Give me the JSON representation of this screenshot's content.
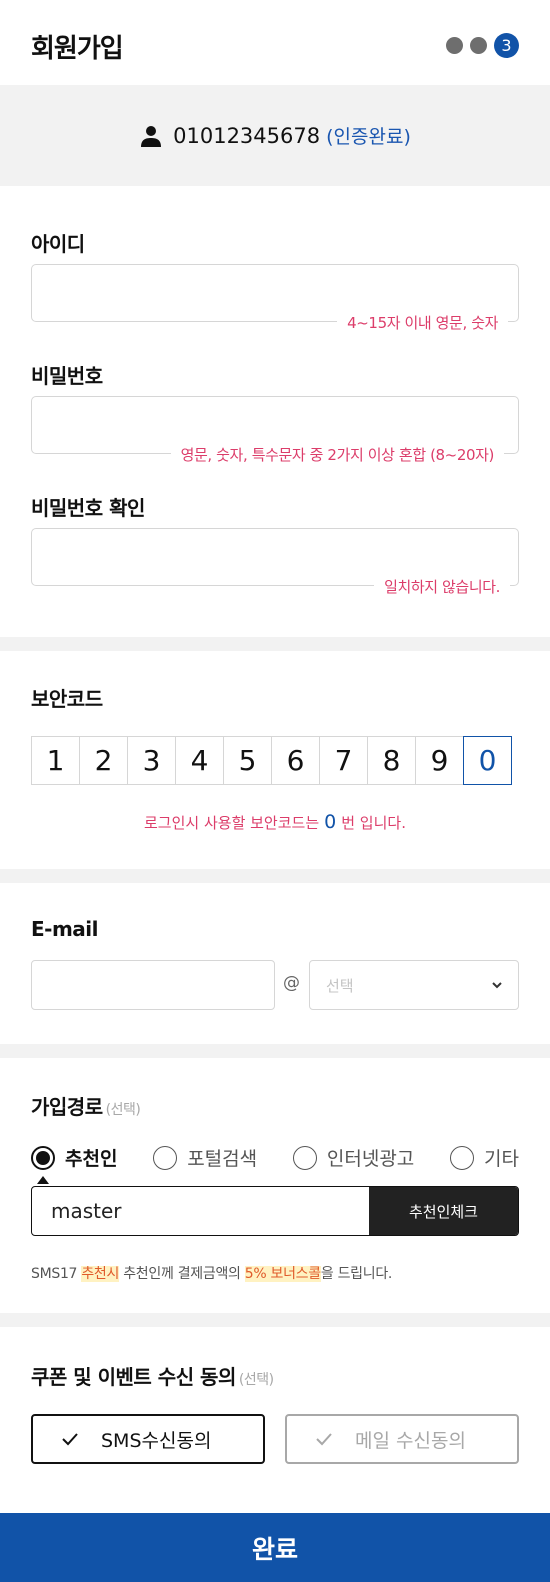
{
  "header": {
    "title": "회원가입",
    "current_step": "3"
  },
  "verification": {
    "phone": "01012345678",
    "status": "(인증완료)"
  },
  "id_field": {
    "label": "아이디",
    "hint": "4~15자 이내 영문, 숫자"
  },
  "password_field": {
    "label": "비밀번호",
    "hint": "영문, 숫자, 특수문자 중 2가지 이상 혼합 (8~20자)"
  },
  "password_confirm": {
    "label": "비밀번호 확인",
    "hint": "일치하지 않습니다."
  },
  "security_code": {
    "label": "보안코드",
    "digits": [
      "1",
      "2",
      "3",
      "4",
      "5",
      "6",
      "7",
      "8",
      "9",
      "0"
    ],
    "selected": "0",
    "note_prefix": "로그인시 사용할 보안코드는",
    "note_suffix": "번 입니다."
  },
  "email": {
    "label": "E-mail",
    "at": "@",
    "select_placeholder": "선택"
  },
  "signup_path": {
    "label": "가입경로",
    "optional": "(선택)",
    "options": [
      "추천인",
      "포털검색",
      "인터넷광고",
      "기타"
    ],
    "selected": "추천인",
    "referrer_value": "master",
    "check_button": "추천인체크",
    "note": {
      "p1": "SMS17 ",
      "h1": "추천시",
      "p2": " 추천인께 결제금액의 ",
      "h2": "5% 보너스콜",
      "p3": "을 드립니다."
    }
  },
  "consent": {
    "label": "쿠폰 및 이벤트 수신 동의",
    "optional": "(선택)",
    "sms": "SMS수신동의",
    "mail": "메일 수신동의"
  },
  "submit_label": "완료",
  "colors": {
    "primary": "#1153a8",
    "error": "#dc3d6a",
    "highlight_bg": "#fff2c2",
    "highlight_text": "#e05a2a"
  }
}
